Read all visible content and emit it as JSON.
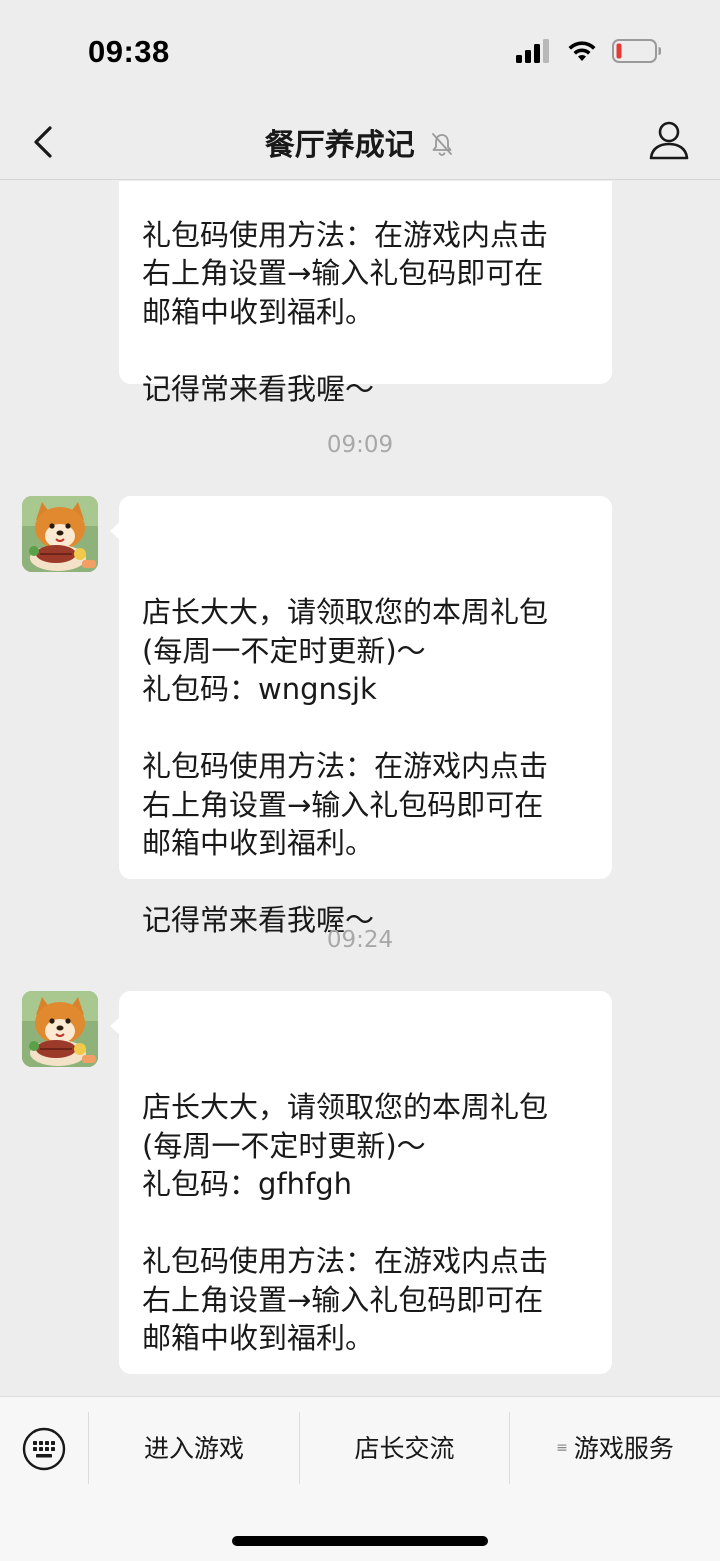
{
  "status_bar": {
    "time": "09:38"
  },
  "nav": {
    "title": "餐厅养成记"
  },
  "messages": [
    {
      "partial": true,
      "text": "礼包码使用方法：在游戏内点击\n右上角设置→输入礼包码即可在\n邮箱中收到福利。\n\n记得常来看我喔～"
    },
    {
      "timestamp": "09:09",
      "text": "店长大大，请领取您的本周礼包\n(每周一不定时更新)～\n礼包码：wngnsjk\n\n礼包码使用方法：在游戏内点击\n右上角设置→输入礼包码即可在\n邮箱中收到福利。\n\n记得常来看我喔～"
    },
    {
      "timestamp": "09:24",
      "text": "店长大大，请领取您的本周礼包\n(每周一不定时更新)～\n礼包码：gfhfgh\n\n礼包码使用方法：在游戏内点击\n右上角设置→输入礼包码即可在\n邮箱中收到福利。\n\n记得常来看我喔～"
    }
  ],
  "menu": {
    "items": [
      {
        "label": "进入游戏"
      },
      {
        "label": "店长交流"
      },
      {
        "label": "游戏服务",
        "has_submenu_icon": true
      }
    ]
  },
  "icons": {
    "back": "chevron-left-icon",
    "mute": "bell-muted-icon",
    "profile": "person-icon",
    "keyboard": "keyboard-icon"
  },
  "colors": {
    "background": "#ededed",
    "bubble": "#ffffff",
    "timestamp": "#a8a8a8",
    "battery_low": "#e53935"
  }
}
